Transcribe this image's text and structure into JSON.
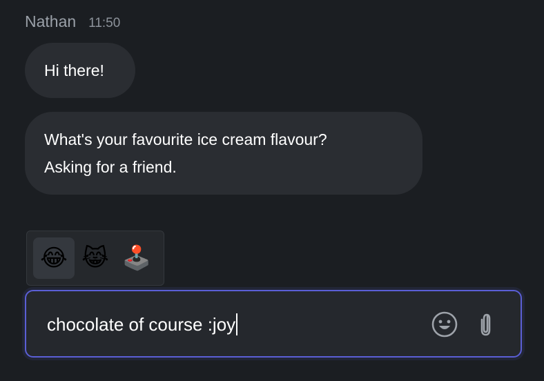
{
  "message": {
    "sender": "Nathan",
    "time": "11:50",
    "bubbles": [
      {
        "lines": [
          "Hi there!"
        ]
      },
      {
        "lines": [
          "What's your favourite ice cream flavour?",
          "Asking for a friend."
        ]
      }
    ]
  },
  "emoji_suggestions": [
    {
      "name": "joy",
      "glyph": "😂",
      "selected": true
    },
    {
      "name": "joy_cat",
      "glyph": "😹",
      "selected": false
    },
    {
      "name": "joystick",
      "glyph": "🕹️",
      "selected": false
    }
  ],
  "composer": {
    "value": "chocolate of course :joy",
    "emoji_button_icon": "smiley-face-icon",
    "attach_button_icon": "paperclip-icon"
  },
  "colors": {
    "background": "#1b1e22",
    "bubble": "#2a2d32",
    "composer_border": "#5b5fd6",
    "icon": "#9ea3aa"
  }
}
